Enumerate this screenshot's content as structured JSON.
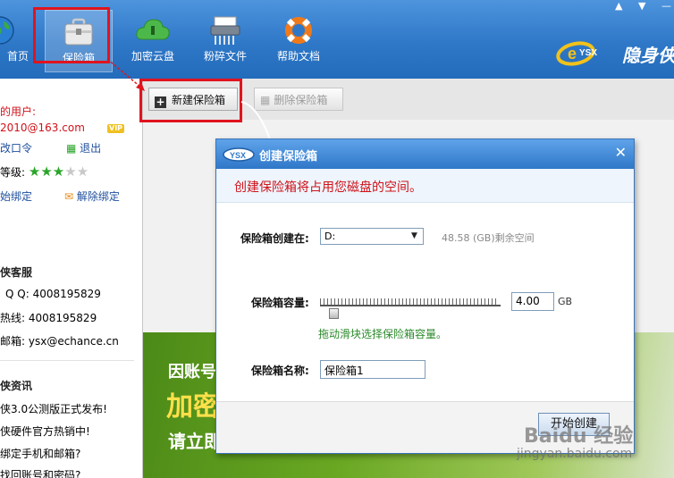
{
  "nav": {
    "items": [
      {
        "label": "首页"
      },
      {
        "label": "保险箱"
      },
      {
        "label": "加密云盘"
      },
      {
        "label": "粉碎文件"
      },
      {
        "label": "帮助文档"
      }
    ],
    "logo_text": "隐身侠"
  },
  "user": {
    "label": "的用户:",
    "email": "2010@163.com",
    "vip": "VIP",
    "change_pwd": "改口令",
    "logout": "退出",
    "level_label": "等级:",
    "level_stars": 3,
    "level_max": 5,
    "bind": "始绑定",
    "unbind": "解除绑定"
  },
  "service": {
    "title": "侠客服",
    "qq": "Q Q: 4008195829",
    "hotline": "热线: 4008195829",
    "email": "邮箱: ysx@echance.cn"
  },
  "news": {
    "title": "侠资讯",
    "items": [
      "侠3.0公测版正式发布!",
      "侠硬件官方热销中!",
      "绑定手机和邮箱?",
      "找回账号和密码?"
    ]
  },
  "toolbar": {
    "new_vault": "新建保险箱",
    "delete_vault": "删除保险箱"
  },
  "banner": {
    "line1": "因账号",
    "line2": "加密",
    "line3": "请立即"
  },
  "dialog": {
    "title": "创建保险箱",
    "notice": "创建保险箱将占用您磁盘的空间。",
    "location_label": "保险箱创建在:",
    "location_value": "D:",
    "free_space": "48.58 (GB)剩余空间",
    "capacity_label": "保险箱容量:",
    "capacity_value": "4.00",
    "capacity_unit": "GB",
    "slider_hint": "拖动滑块选择保险箱容量。",
    "name_label": "保险箱名称:",
    "name_value": "保险箱1",
    "start_button": "开始创建"
  },
  "watermark": {
    "brand": "Baidu 经验",
    "url": "jingyan.baidu.com"
  },
  "colors": {
    "header_blue": "#2f78c8",
    "highlight_red": "#e0141e",
    "notice_red": "#d0121a",
    "hint_green": "#2b8a2b"
  }
}
